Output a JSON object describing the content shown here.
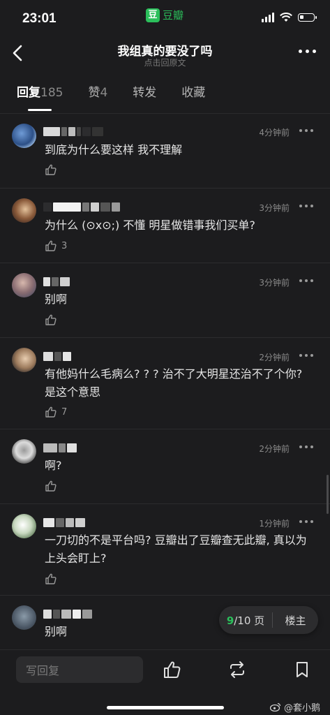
{
  "status_bar": {
    "time": "23:01",
    "app_badge": "豆瓣"
  },
  "nav": {
    "title": "我组真的要没了吗",
    "subtitle": "点击回原文"
  },
  "tabs": [
    {
      "label": "回复",
      "count": "185",
      "active": true
    },
    {
      "label": "赞",
      "count": "4",
      "active": false
    },
    {
      "label": "转发",
      "count": "",
      "active": false
    },
    {
      "label": "收藏",
      "count": "",
      "active": false
    }
  ],
  "comments": [
    {
      "time": "4分钟前",
      "text": "到底为什么要这样 我不理解",
      "likes": ""
    },
    {
      "time": "3分钟前",
      "text": "为什么 (⊙x⊙;) 不懂 明星做错事我们买单?",
      "likes": "3"
    },
    {
      "time": "3分钟前",
      "text": "别啊",
      "likes": ""
    },
    {
      "time": "2分钟前",
      "text": "有他妈什么毛病么? ? ? 治不了大明星还治不了个你? 是这个意思",
      "likes": "7"
    },
    {
      "time": "2分钟前",
      "text": "啊?",
      "likes": ""
    },
    {
      "time": "1分钟前",
      "text": "一刀切的不是平台吗? 豆瓣出了豆瓣查无此瓣, 真以为上头会盯上?",
      "likes": ""
    },
    {
      "time": "",
      "text": "别啊",
      "likes": ""
    }
  ],
  "pager": {
    "current": "9",
    "total": "/10 页",
    "host_label": "楼主"
  },
  "bottom_bar": {
    "reply_placeholder": "写回复"
  },
  "watermark": "@套小鹅",
  "colors": {
    "accent": "#2bbf5b",
    "background": "#1c1c1e",
    "text": "#e6e6e6",
    "muted": "#8a8a8a"
  }
}
